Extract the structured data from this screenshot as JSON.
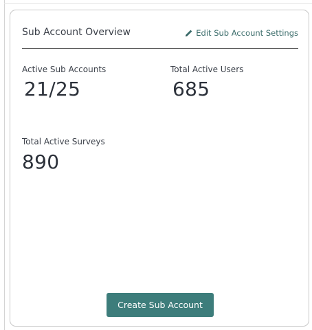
{
  "card": {
    "title": "Sub Account Overview",
    "edit_link": {
      "icon": "pencil-icon",
      "label": "Edit Sub Account Settings"
    },
    "stats": {
      "active_sub_accounts": {
        "label": "Active Sub Accounts",
        "value": "21/25"
      },
      "total_active_users": {
        "label": "Total Active Users",
        "value": "685"
      },
      "total_active_surveys": {
        "label": "Total Active Surveys",
        "value": "890"
      }
    },
    "create_button_label": "Create Sub Account"
  },
  "colors": {
    "accent": "#3d7d7b",
    "link": "#3a6c6a",
    "text": "#3a3f48"
  }
}
